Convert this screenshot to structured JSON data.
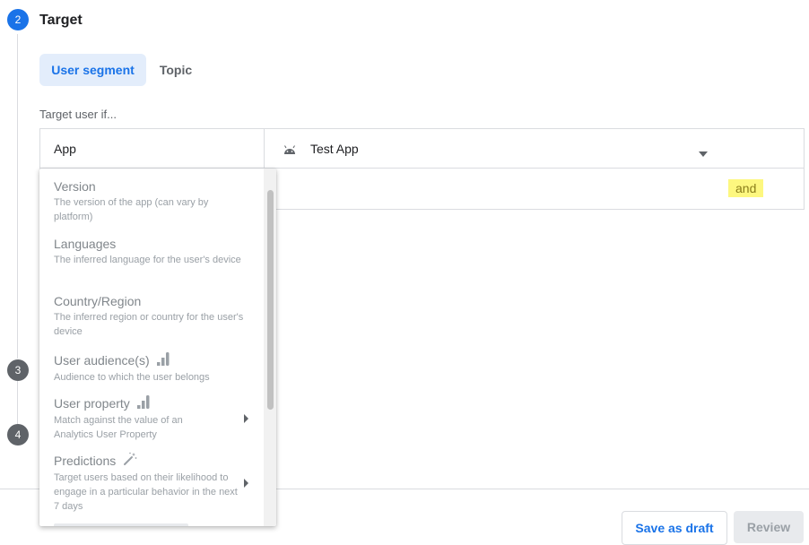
{
  "steps": [
    {
      "number": "2",
      "title": "Target",
      "color": "#1a73e8"
    },
    {
      "number": "3",
      "color": "#5f6368"
    },
    {
      "number": "4",
      "color": "#5f6368"
    }
  ],
  "tabs": [
    {
      "label": "User segment",
      "active": true
    },
    {
      "label": "Topic",
      "active": false
    }
  ],
  "target_label": "Target user if...",
  "condition": {
    "field_value": "App",
    "app_icon": "android-icon",
    "app_value": "Test App",
    "and_label": "and"
  },
  "dropdown_options": [
    {
      "title": "Version",
      "description": "The version of the app (can vary by platform)",
      "icon": "",
      "submenu": false
    },
    {
      "title": "Languages",
      "description": "The inferred language for the user's device",
      "icon": "",
      "submenu": false
    },
    {
      "title": "Country/Region",
      "description": "The inferred region or country for the user's device",
      "icon": "",
      "submenu": false
    },
    {
      "title": "User audience(s)",
      "description": "Audience to which the user belongs",
      "icon": "analytics-icon",
      "submenu": false
    },
    {
      "title": "User property",
      "description": "Match against the value of an Analytics User Property",
      "icon": "analytics-icon",
      "submenu": true
    },
    {
      "title": "Predictions",
      "description": "Target users based on their likelihood to engage in a particular behavior in the next 7 days",
      "icon": "magic-wand-icon",
      "submenu": true
    }
  ],
  "footer": {
    "save_draft": "Save as draft",
    "review": "Review"
  }
}
